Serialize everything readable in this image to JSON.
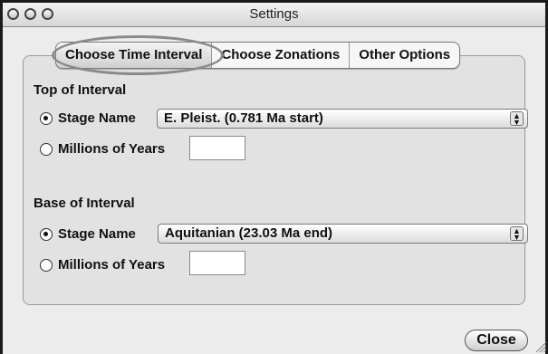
{
  "window": {
    "title": "Settings"
  },
  "tabs": [
    {
      "label": "Choose Time Interval",
      "selected": true
    },
    {
      "label": "Choose Zonations",
      "selected": false
    },
    {
      "label": "Other Options",
      "selected": false
    }
  ],
  "top_interval": {
    "heading": "Top of Interval",
    "stage_radio_label": "Stage Name",
    "stage_selected": true,
    "stage_value": "E. Pleist. (0.781 Ma start)",
    "years_radio_label": "Millions of Years",
    "years_value": ""
  },
  "base_interval": {
    "heading": "Base of Interval",
    "stage_radio_label": "Stage Name",
    "stage_selected": true,
    "stage_value": "Aquitanian (23.03 Ma end)",
    "years_radio_label": "Millions of Years",
    "years_value": ""
  },
  "buttons": {
    "close_label": "Close"
  },
  "icons": {
    "select_arrows": "updown-arrows-icon",
    "resize": "resize-grip-icon"
  }
}
